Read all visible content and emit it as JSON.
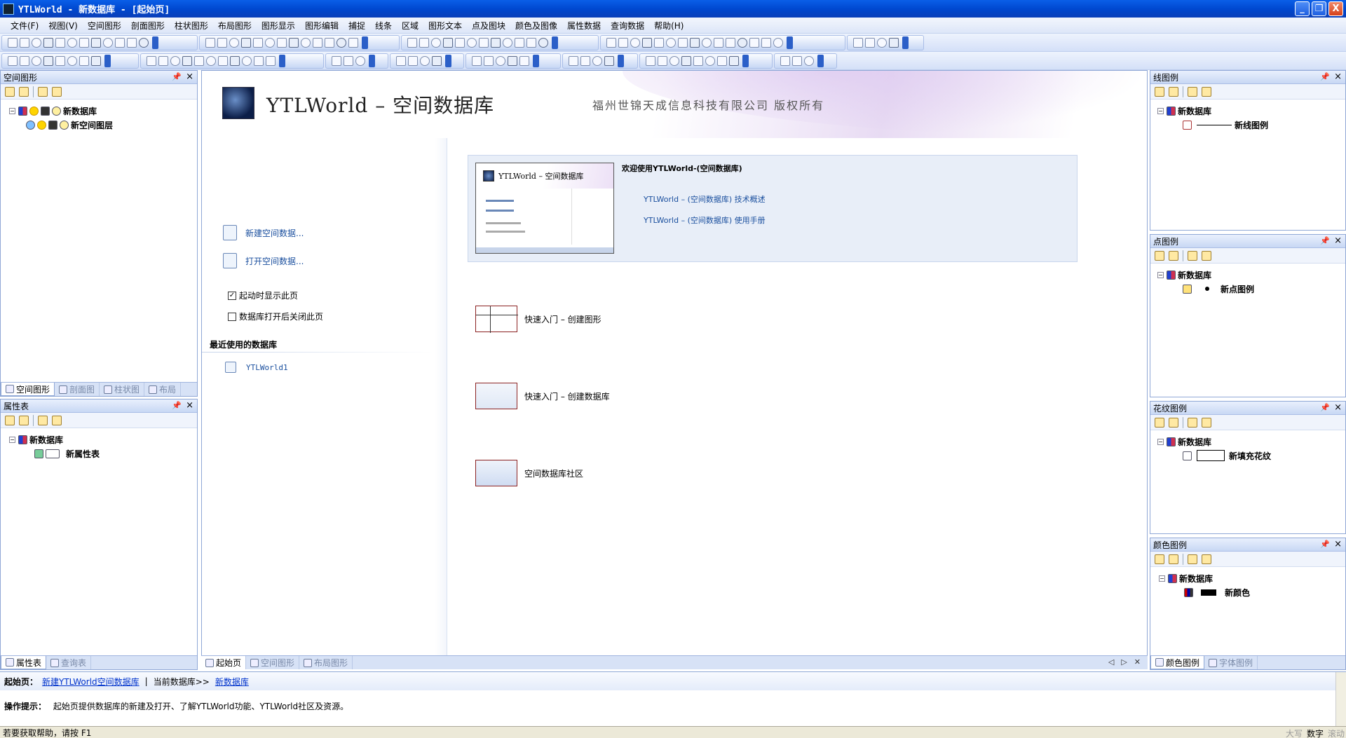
{
  "window": {
    "title": "YTLWorld - 新数据库 - [起始页]",
    "controls": [
      "_",
      "❐",
      "X"
    ]
  },
  "menu": [
    "文件(F)",
    "视图(V)",
    "空间图形",
    "剖面图形",
    "柱状图形",
    "布局图形",
    "图形显示",
    "图形编辑",
    "捕捉",
    "线条",
    "区域",
    "图形文本",
    "点及图块",
    "颜色及图像",
    "属性数据",
    "查询数据",
    "帮助(H)"
  ],
  "left_panels": {
    "spatial": {
      "title": "空间图形",
      "tree": {
        "root": "新数据库",
        "child": "新空间图层"
      },
      "tabs": [
        "空间图形",
        "剖面图",
        "柱状图",
        "布局"
      ]
    },
    "attr": {
      "title": "属性表",
      "tree": {
        "root": "新数据库",
        "child": "新属性表"
      },
      "tabs": [
        "属性表",
        "查询表"
      ]
    }
  },
  "start_page": {
    "banner_title": "YTLWorld – 空间数据库",
    "banner_company": "福州世锦天成信息科技有限公司 版权所有",
    "new_db": "新建空间数据...",
    "open_db": "打开空间数据...",
    "chk_show": "起动时显示此页",
    "chk_close": "数据库打开后关闭此页",
    "chk_show_checked": true,
    "chk_close_checked": false,
    "recent_heading": "最近使用的数据库",
    "recent_item": "YTLWorld1",
    "welcome_title": "欢迎使用YTLWorld-(空间数据库)",
    "link_overview": "YTLWorld – (空间数据库) 技术概述",
    "link_manual": "YTLWorld – (空间数据库) 使用手册",
    "preview_title": "YTLWorld – 空间数据库",
    "quick1": "快速入门 – 创建图形",
    "quick2": "快速入门 – 创建数据库",
    "community": "空间数据库社区"
  },
  "doc_tabs": [
    "起始页",
    "空间图形",
    "布局图形"
  ],
  "right_panels": {
    "line": {
      "title": "线图例",
      "root": "新数据库",
      "child": "新线图例"
    },
    "point": {
      "title": "点图例",
      "root": "新数据库",
      "child": "新点图例"
    },
    "pattern": {
      "title": "花纹图例",
      "root": "新数据库",
      "child": "新填充花纹"
    },
    "color": {
      "title": "颜色图例",
      "root": "新数据库",
      "child": "新颜色",
      "tabs": [
        "颜色图例",
        "字体图例"
      ]
    }
  },
  "info": {
    "start_label": "起始页：",
    "new_link": "新建YTLWorld空间数据库",
    "current_label": "当前数据库>>",
    "current_link": "新数据库",
    "hint_label": "操作提示：",
    "hint_text": "起始页提供数据库的新建及打开、了解YTLWorld功能、YTLWorld社区及资源。"
  },
  "status": {
    "help": "若要获取帮助，请按 F1",
    "caps": "大写",
    "num": "数字",
    "scroll": "滚动"
  },
  "colors": {
    "title_bar": "#0a5fe8",
    "link": "#1a4f9e",
    "panel_border": "#8fa7d6"
  }
}
